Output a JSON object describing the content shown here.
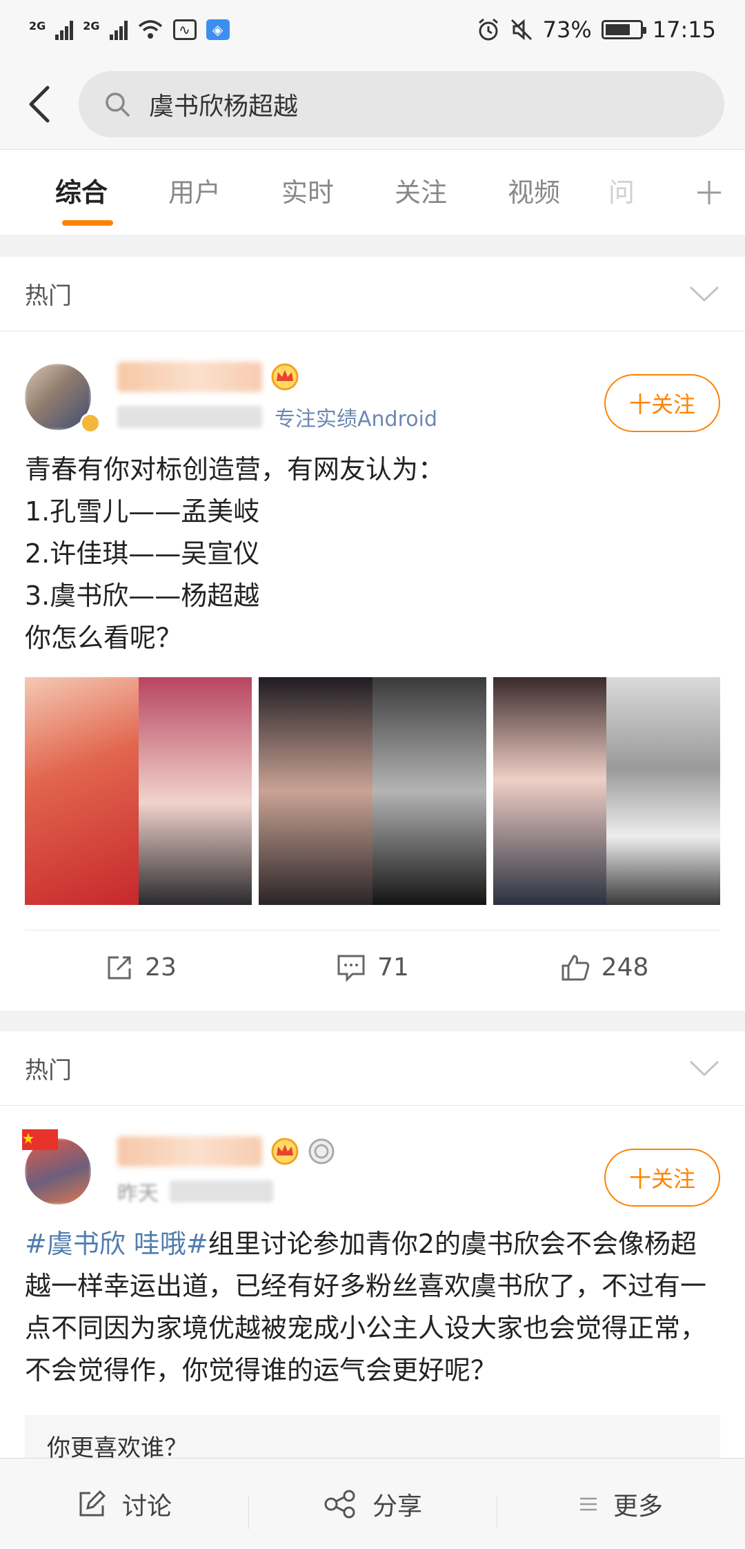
{
  "status_bar": {
    "signal1_net": "2G",
    "signal2_net": "2G",
    "battery_percent": "73%",
    "time": "17:15",
    "icons": [
      "signal-icon",
      "signal-icon",
      "wifi-icon",
      "pulse-icon",
      "shield-icon",
      "alarm-icon",
      "mute-icon",
      "battery-icon"
    ]
  },
  "search": {
    "query": "虞书欣杨超越"
  },
  "tabs": [
    {
      "label": "综合",
      "active": true
    },
    {
      "label": "用户",
      "active": false
    },
    {
      "label": "实时",
      "active": false
    },
    {
      "label": "关注",
      "active": false
    },
    {
      "label": "视频",
      "active": false
    },
    {
      "label": "问",
      "active": false
    }
  ],
  "posts": [
    {
      "section_label": "热门",
      "source": "专注实绩Android",
      "follow_label": "十关注",
      "content_lines": [
        "青春有你对标创造营，有网友认为：",
        "1.孔雪儿——孟美岐",
        "2.许佳琪——吴宣仪",
        "3.虞书欣——杨超越",
        "你怎么看呢？"
      ],
      "photo_colors": [
        [
          "#d94b3a",
          "#c9868d"
        ],
        [
          "#3b3236",
          "#2a2a2a"
        ],
        [
          "#3c3c44",
          "#c2c2c2"
        ]
      ],
      "actions": {
        "repost": "23",
        "comment": "71",
        "like": "248"
      }
    },
    {
      "section_label": "热门",
      "meta_time": "昨天",
      "follow_label": "十关注",
      "topic": "#虞书欣 哇哦#",
      "content": "组里讨论参加青你2的虞书欣会不会像杨超越一样幸运出道，已经有好多粉丝喜欢虞书欣了，不过有一点不同因为家境优越被宠成小公主人设大家也会觉得正常，不会觉得作，你觉得谁的运气会更好呢？",
      "poll_title": "你更喜欢谁？"
    }
  ],
  "bottom_bar": {
    "discuss": "讨论",
    "share": "分享",
    "more": "更多"
  },
  "colors": {
    "accent": "#ff8200",
    "link": "#507daf"
  }
}
